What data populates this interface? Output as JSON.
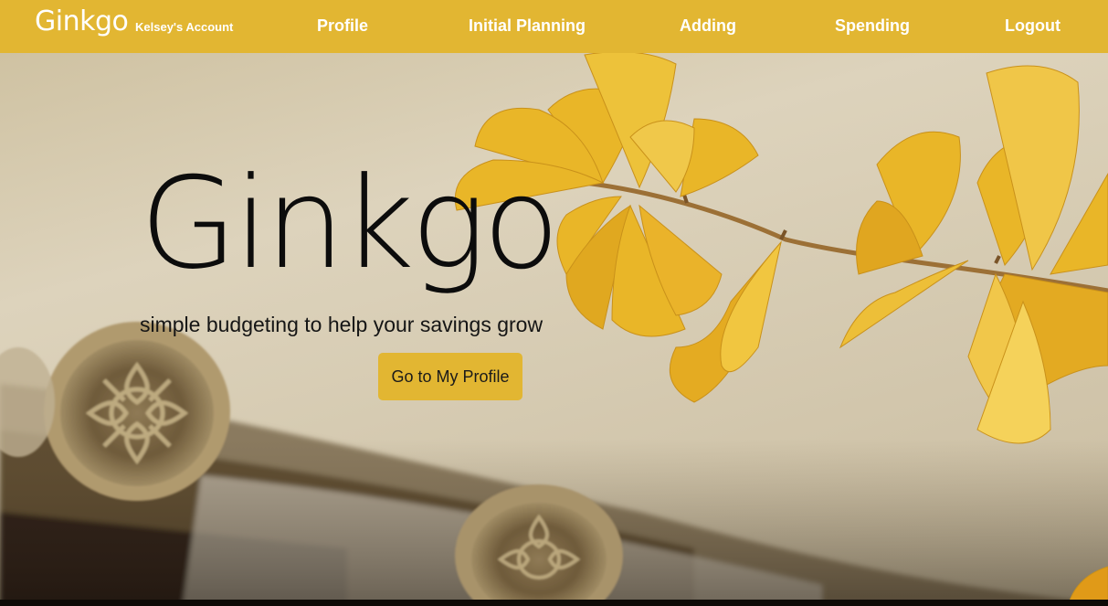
{
  "navbar": {
    "brand": "Ginkgo",
    "account": "Kelsey's Account",
    "links": [
      "Profile",
      "Initial Planning",
      "Adding",
      "Spending",
      "Logout"
    ]
  },
  "hero": {
    "title": "Ginkgo",
    "subtitle": "simple budgeting to help your savings grow",
    "button_label": "Go to My Profile",
    "background_image": "ginkgo-branch-and-roof-tiles-photo"
  },
  "colors": {
    "brand_gold": "#e2b632",
    "nav_text": "#ffffff",
    "title_text": "#0c0c0c",
    "leaf_yellow": "#e9b628",
    "background": "#d8ceb6"
  }
}
